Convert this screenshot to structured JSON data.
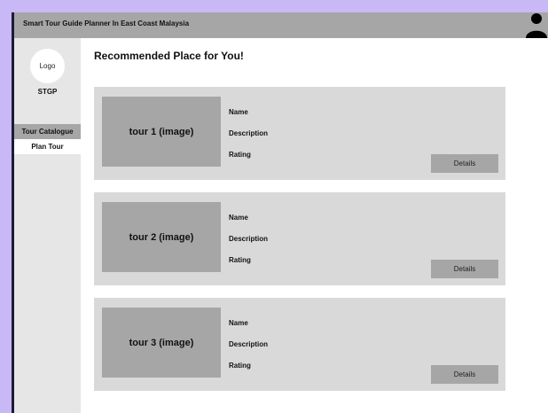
{
  "header": {
    "title": "Smart Tour Guide Planner In East Coast Malaysia",
    "user_icon": "user-icon"
  },
  "sidebar": {
    "logo_label": "Logo",
    "brand": "STGP",
    "items": [
      {
        "label": "Tour Catalogue",
        "active": true
      },
      {
        "label": "Plan Tour",
        "active": false
      }
    ]
  },
  "main": {
    "title": "Recommended Place for You!",
    "tours": [
      {
        "image_label": "tour 1 (image)",
        "name_label": "Name",
        "description_label": "Description",
        "rating_label": "Rating",
        "button_label": "Details"
      },
      {
        "image_label": "tour 2 (image)",
        "name_label": "Name",
        "description_label": "Description",
        "rating_label": "Rating",
        "button_label": "Details"
      },
      {
        "image_label": "tour 3 (image)",
        "name_label": "Name",
        "description_label": "Description",
        "rating_label": "Rating",
        "button_label": "Details"
      }
    ]
  },
  "colors": {
    "background_purple": "#c9b8f6",
    "header_gray": "#a6a6a6",
    "sidebar_gray": "#e6e6e6",
    "card_gray": "#d9d9d9",
    "image_gray": "#a6a6a6"
  }
}
